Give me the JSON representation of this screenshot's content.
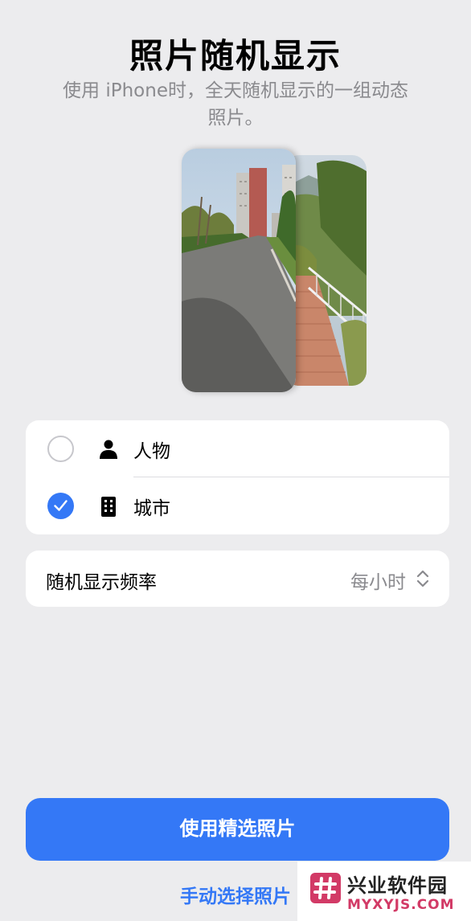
{
  "header": {
    "title": "照片随机显示",
    "subtitle": "使用 iPhone时，全天随机显示的一组动态照片。"
  },
  "options": [
    {
      "label": "人物",
      "icon": "person-icon",
      "selected": false
    },
    {
      "label": "城市",
      "icon": "building-icon",
      "selected": true
    }
  ],
  "frequency": {
    "label": "随机显示频率",
    "value": "每小时",
    "icon": "up-down-chevron-icon"
  },
  "actions": {
    "primary_label": "使用精选照片",
    "secondary_label": "手动选择照片"
  },
  "watermark": {
    "name": "兴业软件园",
    "url": "MYXYJS.COM"
  },
  "colors": {
    "accent": "#3478f6",
    "background": "#ececee",
    "secondary_text": "#8a8a8e",
    "watermark_pink": "#d23a66"
  }
}
